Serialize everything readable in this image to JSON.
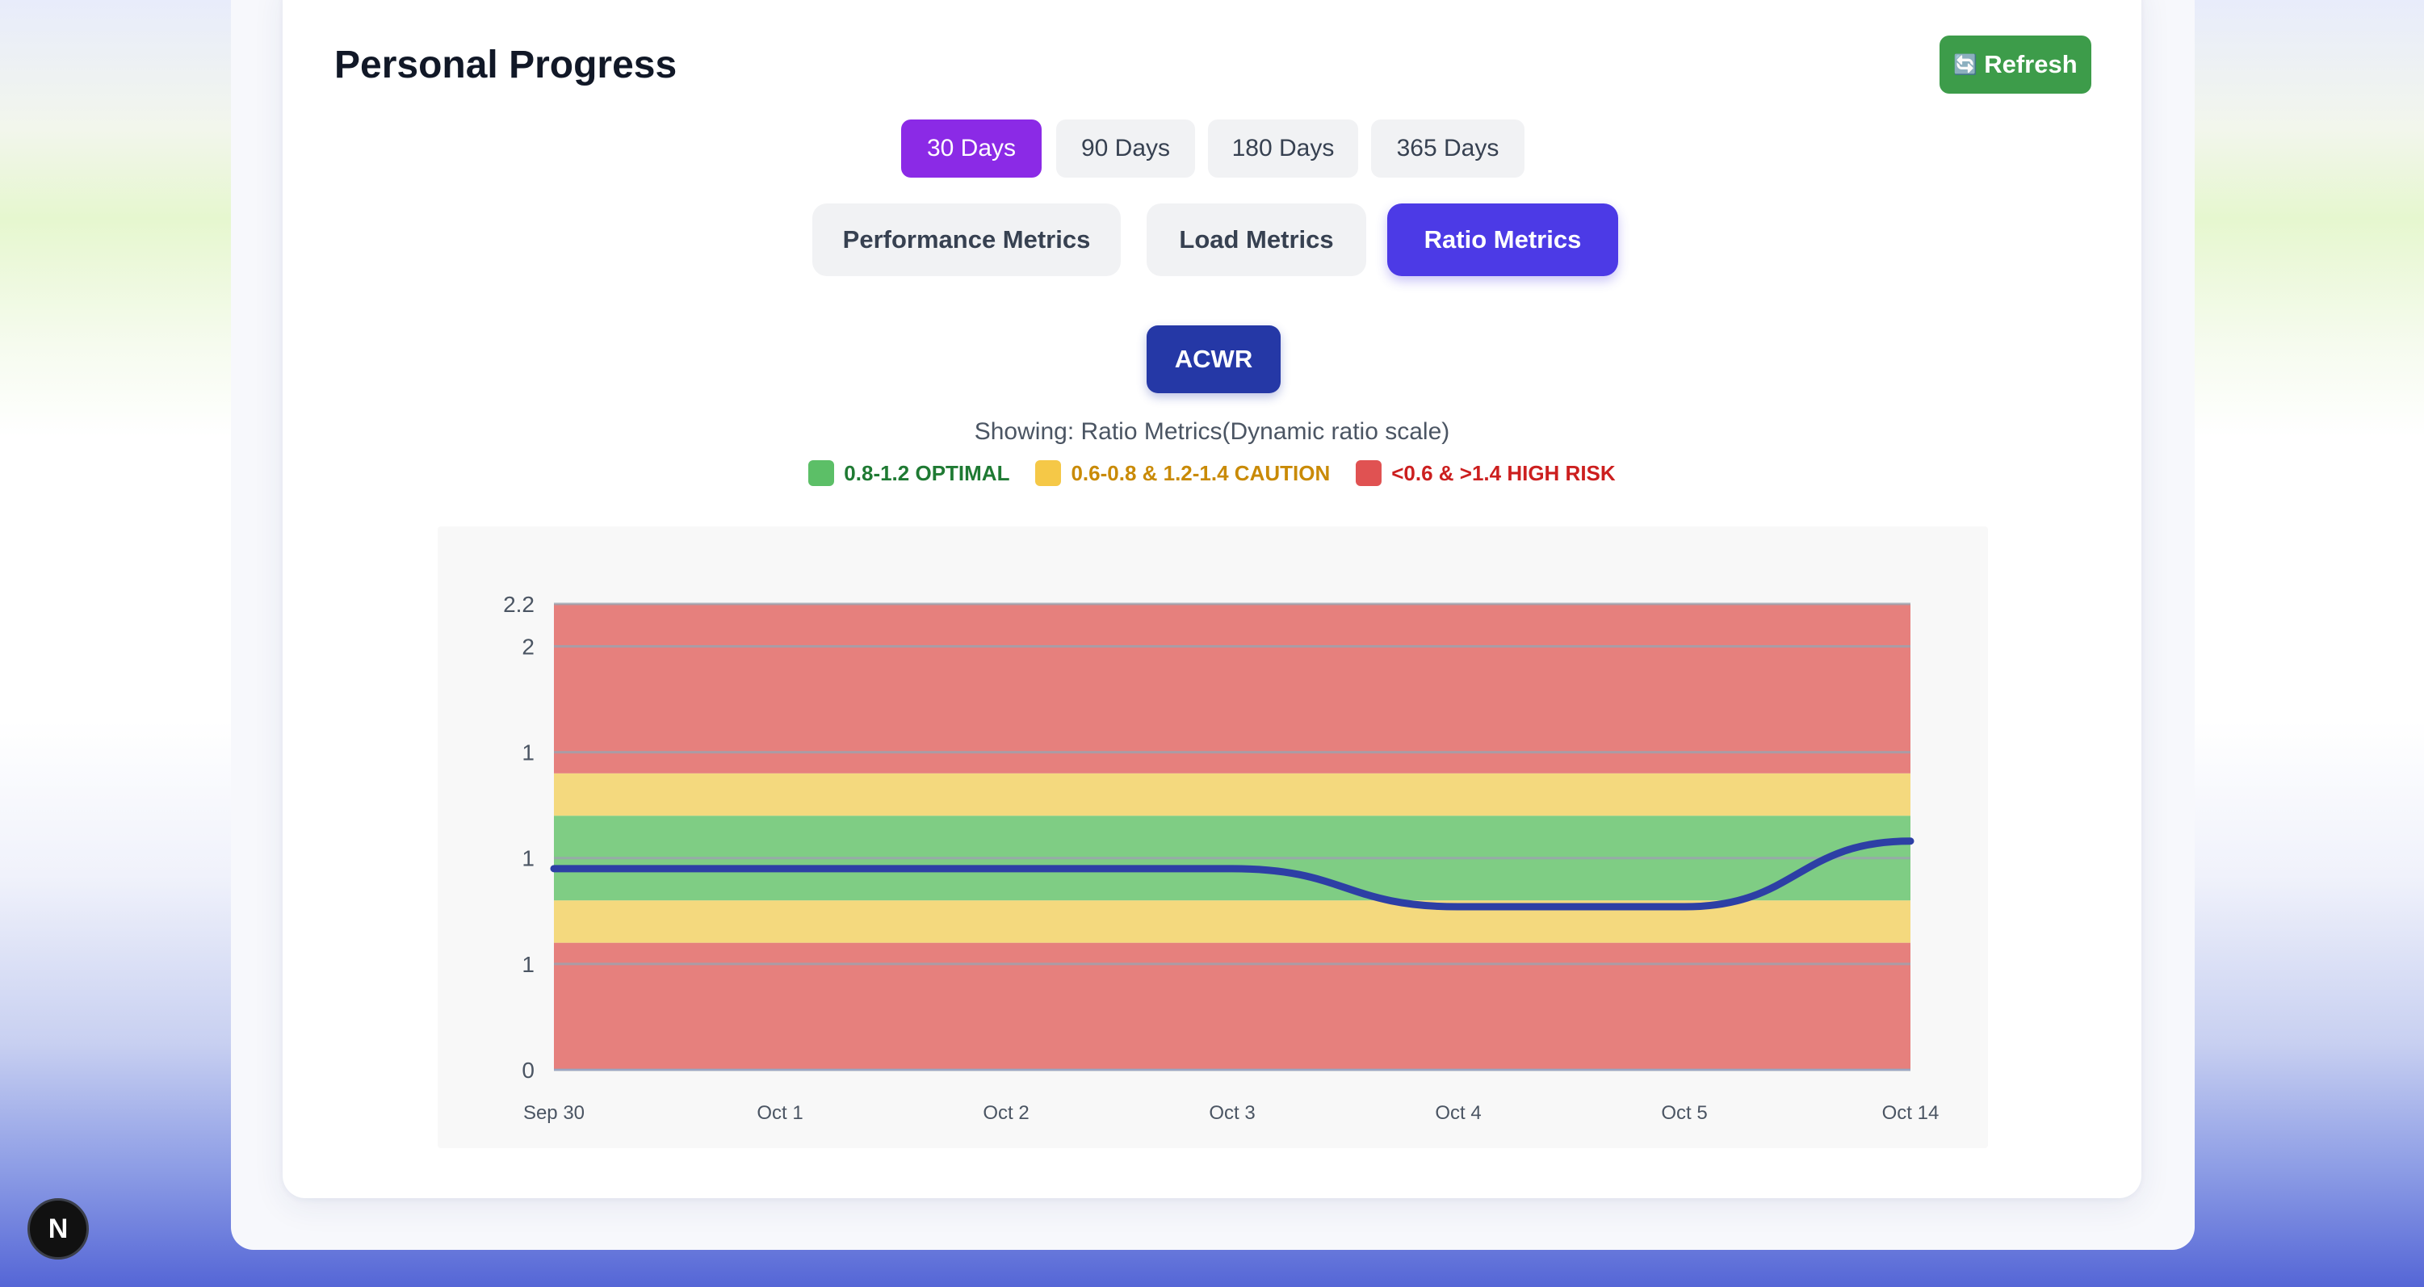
{
  "header": {
    "title": "Personal Progress",
    "refresh_icon": "refresh-icon",
    "refresh_label": "Refresh"
  },
  "time_ranges": {
    "options": [
      "30 Days",
      "90 Days",
      "180 Days",
      "365 Days"
    ],
    "selected": "30 Days"
  },
  "metric_tabs": {
    "options": [
      "Performance Metrics",
      "Load Metrics",
      "Ratio Metrics"
    ],
    "selected": "Ratio Metrics"
  },
  "metric_button": "ACWR",
  "showing_text": "Showing: Ratio Metrics(Dynamic ratio scale)",
  "legend": [
    {
      "label": "0.8-1.2 OPTIMAL",
      "color": "#5cbf67",
      "text_color": "#1f7a33"
    },
    {
      "label": "0.6-0.8 & 1.2-1.4 CAUTION",
      "color": "#f5c847",
      "text_color": "#c98a06"
    },
    {
      "label": "<0.6 & >1.4 HIGH RISK",
      "color": "#e05252",
      "text_color": "#cc1f1f"
    }
  ],
  "colors": {
    "optimal_band": "#7fcd84",
    "caution_band": "#f4d97e",
    "high_risk_band": "#e6807d",
    "series_line": "#2d3fa5",
    "refresh_button": "#3d9c4a",
    "active_range": "#8b2ae6",
    "active_metric": "#4c3ae6",
    "acwr_button": "#2538a6"
  },
  "chart_data": {
    "type": "line",
    "x": [
      "Sep 30",
      "Oct 1",
      "Oct 2",
      "Oct 3",
      "Oct 4",
      "Oct 5",
      "Oct 14"
    ],
    "series": [
      {
        "values": [
          0.95,
          0.95,
          0.95,
          0.95,
          0.77,
          0.77,
          1.08
        ]
      }
    ],
    "ylim": [
      0,
      2.2
    ],
    "ytick_values": [
      0,
      0.5,
      1,
      1.5,
      2,
      2.2
    ],
    "ytick_labels": [
      "0",
      "1",
      "1",
      "1",
      "2",
      "2.2"
    ],
    "bands": [
      {
        "from": 0,
        "to": 0.6,
        "zone": "high risk"
      },
      {
        "from": 0.6,
        "to": 0.8,
        "zone": "caution"
      },
      {
        "from": 0.8,
        "to": 1.2,
        "zone": "optimal"
      },
      {
        "from": 1.2,
        "to": 1.4,
        "zone": "caution"
      },
      {
        "from": 1.4,
        "to": 2.2,
        "zone": "high risk"
      }
    ],
    "grid": true
  },
  "badge": "N"
}
